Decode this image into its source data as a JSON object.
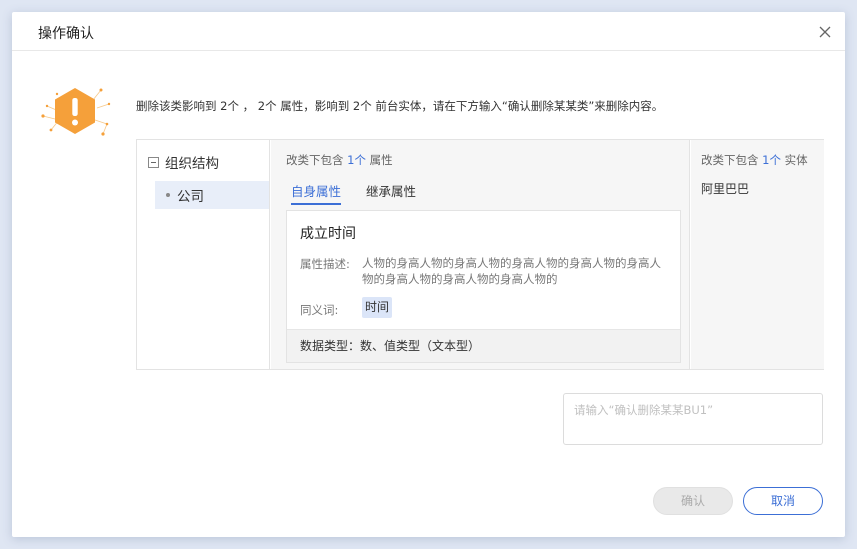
{
  "dialog": {
    "title": "操作确认",
    "warning_message": "删除该类影响到 2个 ， 2个 属性，影响到 2个 前台实体，请在下方输入“确认删除某某类”来删除内容。",
    "accent_color": "#3c6fd6",
    "warning_color": "#f5a03a"
  },
  "tree": {
    "root_label": "组织结构",
    "child_label": "公司"
  },
  "attributes": {
    "head_prefix": "改类下包含",
    "count": "1个",
    "head_suffix": "属性",
    "tabs": [
      {
        "label": "自身属性",
        "active": true
      },
      {
        "label": "继承属性",
        "active": false
      }
    ],
    "card": {
      "name": "成立时间",
      "desc_label": "属性描述:",
      "desc": "人物的身高人物的身高人物的身高人物的身高人物的身高人物的身高人物的身高人物的身高人物的",
      "synonym_label": "同义词:",
      "synonym": "时间",
      "footer": "数据类型：数、值类型（文本型）"
    }
  },
  "entities": {
    "head_prefix": "改类下包含",
    "count": "1个",
    "head_suffix": "实体",
    "items": [
      "阿里巴巴"
    ]
  },
  "confirm_input": {
    "placeholder": "请输入“确认删除某某BU1”",
    "value": ""
  },
  "buttons": {
    "ok_label": "确认",
    "cancel_label": "取消"
  }
}
